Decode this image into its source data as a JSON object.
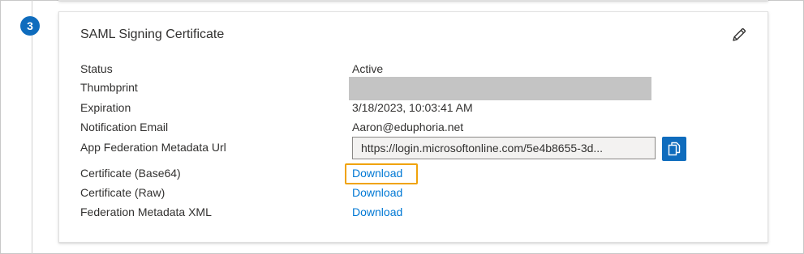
{
  "step": {
    "number": "3"
  },
  "card": {
    "title": "SAML Signing Certificate",
    "fields": {
      "status_label": "Status",
      "status_value": "Active",
      "thumbprint_label": "Thumbprint",
      "expiration_label": "Expiration",
      "expiration_value": "3/18/2023, 10:03:41 AM",
      "notification_email_label": "Notification Email",
      "notification_email_value": "Aaron@eduphoria.net",
      "metadata_url_label": "App Federation Metadata Url",
      "metadata_url_value": "https://login.microsoftonline.com/5e4b8655-3d..."
    },
    "downloads": [
      {
        "label": "Certificate (Base64)",
        "link": "Download"
      },
      {
        "label": "Certificate (Raw)",
        "link": "Download"
      },
      {
        "label": "Federation Metadata XML",
        "link": "Download"
      }
    ]
  },
  "icons": {
    "edit": "pencil-icon",
    "copy": "copy-icon"
  },
  "colors": {
    "accent": "#0f6cbd",
    "link": "#0078d4",
    "highlight": "#f0a30a",
    "redaction": "#c4c4c4"
  }
}
